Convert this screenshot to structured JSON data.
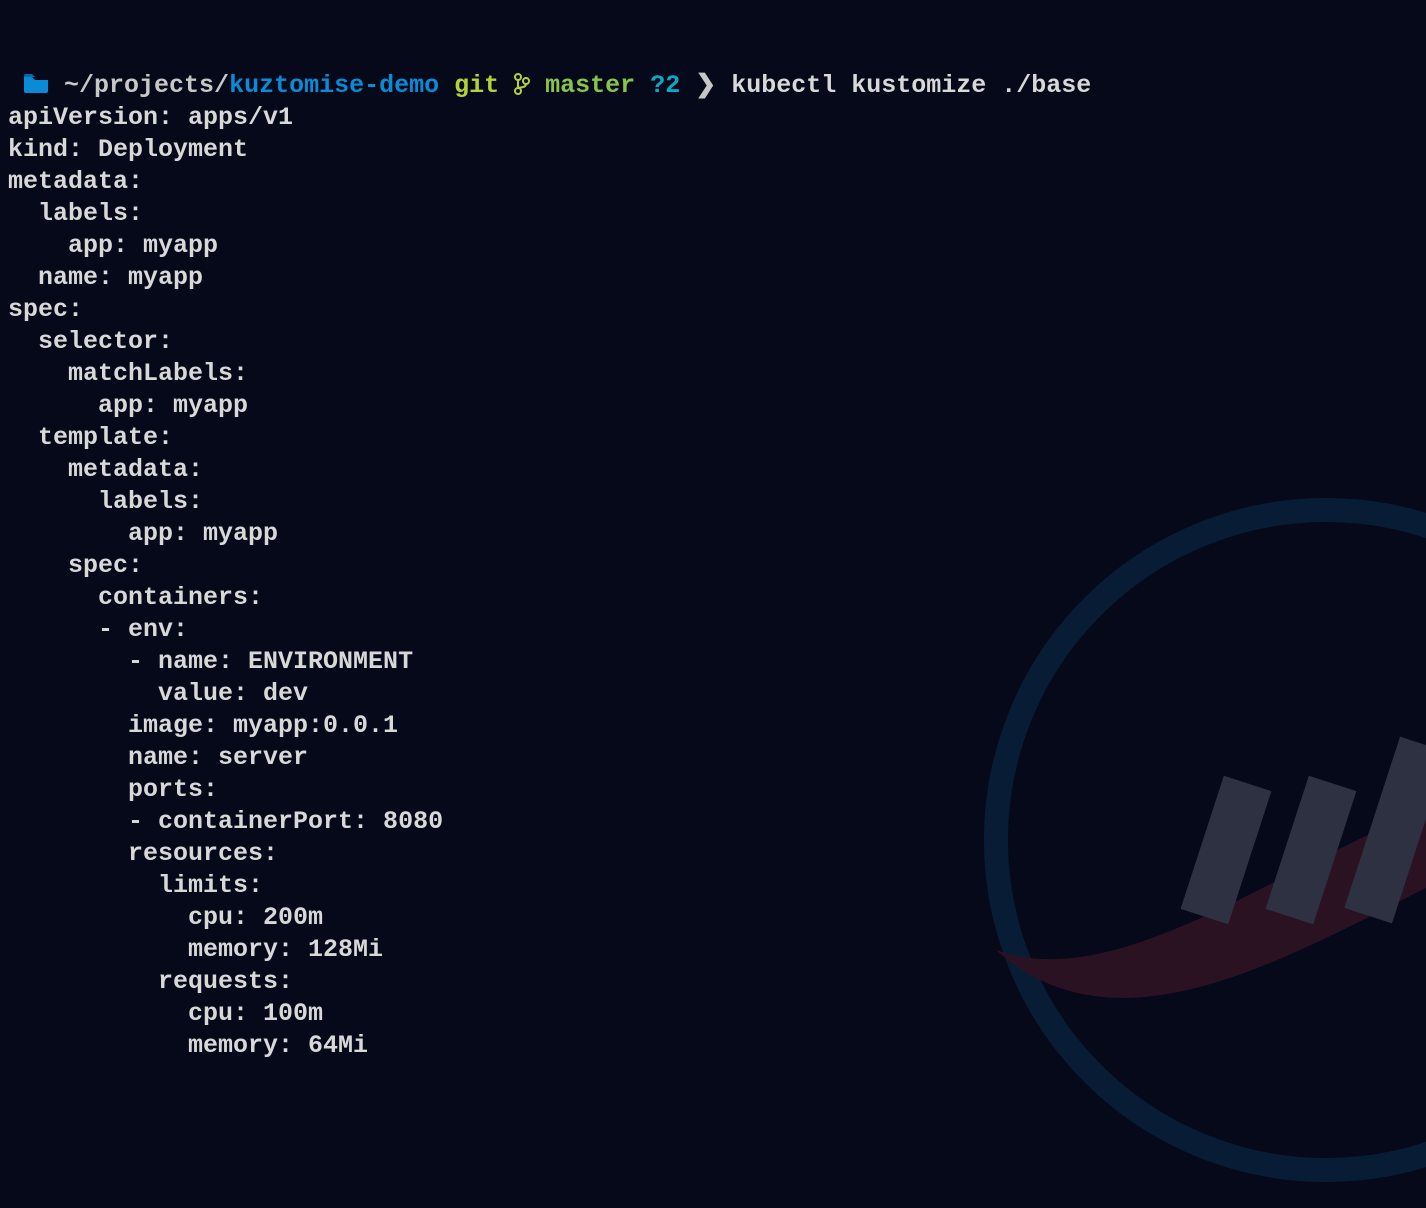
{
  "prompt": {
    "apple_icon": "",
    "folder_icon_name": "folder-icon",
    "path_prefix": "~/projects/",
    "path_dir": "kuztomise-demo",
    "git_label": "git",
    "branch_icon_name": "branch-icon",
    "branch_name": "master",
    "dirty_status": "?2",
    "prompt_arrow": "❯",
    "command": "kubectl kustomize ./base"
  },
  "output_lines": [
    "apiVersion: apps/v1",
    "kind: Deployment",
    "metadata:",
    "  labels:",
    "    app: myapp",
    "  name: myapp",
    "spec:",
    "  selector:",
    "    matchLabels:",
    "      app: myapp",
    "  template:",
    "    metadata:",
    "      labels:",
    "        app: myapp",
    "    spec:",
    "      containers:",
    "      - env:",
    "        - name: ENVIRONMENT",
    "          value: dev",
    "        image: myapp:0.0.1",
    "        name: server",
    "        ports:",
    "        - containerPort: 8080",
    "        resources:",
    "          limits:",
    "            cpu: 200m",
    "            memory: 128Mi",
    "          requests:",
    "            cpu: 100m",
    "            memory: 64Mi"
  ],
  "watermark_icon_name": "nasa-style-logo"
}
